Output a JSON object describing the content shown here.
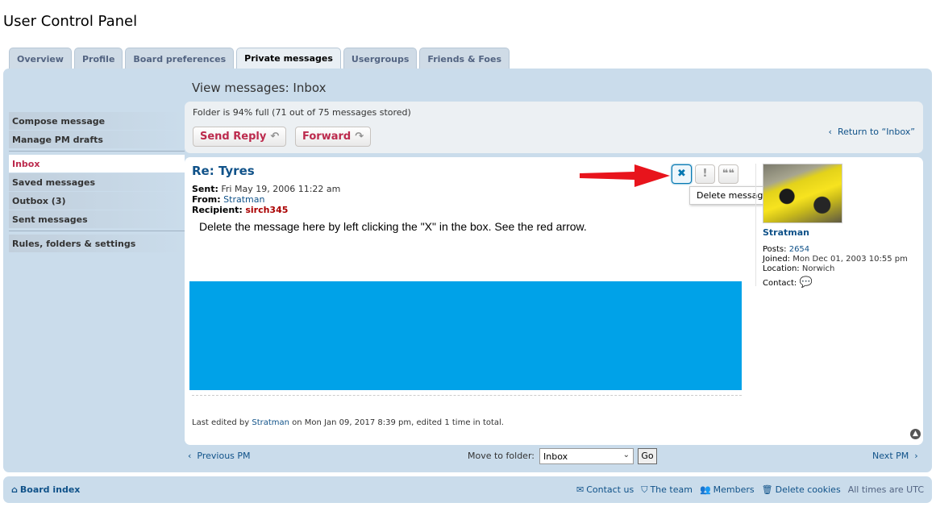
{
  "page_title": "User Control Panel",
  "tabs": [
    {
      "label": "Overview"
    },
    {
      "label": "Profile"
    },
    {
      "label": "Board preferences"
    },
    {
      "label": "Private messages",
      "active": true
    },
    {
      "label": "Usergroups"
    },
    {
      "label": "Friends & Foes"
    }
  ],
  "sidebar": {
    "group1": [
      {
        "label": "Compose message"
      },
      {
        "label": "Manage PM drafts"
      }
    ],
    "group2": [
      {
        "label": "Inbox",
        "active": true
      },
      {
        "label": "Saved messages"
      },
      {
        "label": "Outbox (3)"
      },
      {
        "label": "Sent messages"
      }
    ],
    "group3": [
      {
        "label": "Rules, folders & settings"
      }
    ]
  },
  "main": {
    "view_title": "View messages: Inbox",
    "folder_status": "Folder is 94% full (71 out of 75 messages stored)",
    "send_reply_label": "Send Reply",
    "send_reply_icon": "reply-icon",
    "forward_label": "Forward",
    "forward_icon": "forward-icon",
    "return_link": "Return to “Inbox”"
  },
  "message": {
    "subject": "Re: Tyres",
    "sent_label": "Sent:",
    "sent_value": "Fri May 19, 2006 11:22 am",
    "from_label": "From:",
    "from_value": "Stratman",
    "recipient_label": "Recipient:",
    "recipient_value": "sirch345",
    "body": "Delete the message here by left clicking the \"X\" in the box. See the red arrow.",
    "edited_prefix": "Last edited by",
    "edited_user": "Stratman",
    "edited_suffix": "on Mon Jan 09, 2017 8:39 pm, edited 1 time in total.",
    "tooltip": "Delete message",
    "buttons": {
      "delete_glyph": "✖",
      "report_glyph": "!",
      "quote_glyph": "❝❝"
    },
    "annotation_arrow_color": "#e8141c",
    "image_block_color": "#00a2e8"
  },
  "profile": {
    "username": "Stratman",
    "posts_label": "Posts:",
    "posts_value": "2654",
    "joined_label": "Joined:",
    "joined_value": "Mon Dec 01, 2003 10:55 pm",
    "location_label": "Location:",
    "location_value": "Norwich",
    "contact_label": "Contact:"
  },
  "nav": {
    "previous": "Previous PM",
    "next": "Next PM",
    "move_label": "Move to folder:",
    "move_selected": "Inbox",
    "go_label": "Go"
  },
  "footer": {
    "board_index": "Board index",
    "contact_us": "Contact us",
    "the_team": "The team",
    "members": "Members",
    "delete_cookies": "Delete cookies",
    "timezone": "All times are UTC"
  }
}
